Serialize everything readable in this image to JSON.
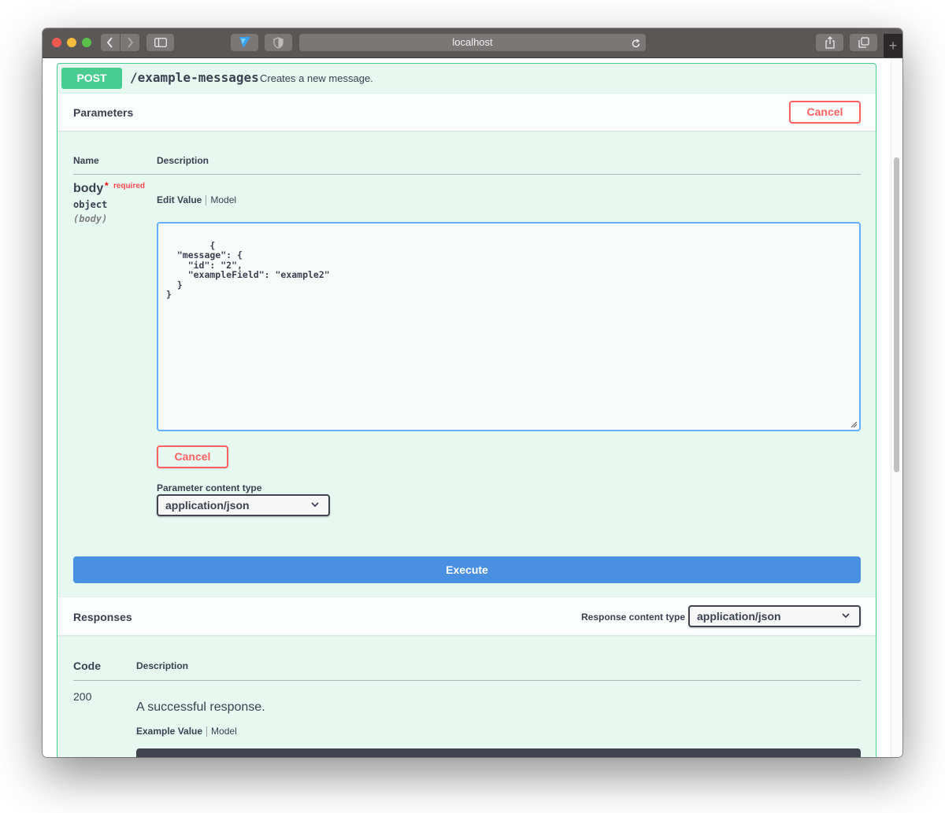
{
  "browser": {
    "url": "localhost",
    "icons": {
      "back": "chevron-left-icon",
      "forward": "chevron-right-icon",
      "sidebar": "sidebar-icon",
      "extension_v": "v-extension-icon",
      "extension_shield": "shield-icon",
      "reload": "reload-icon",
      "share": "share-icon",
      "tabs": "tabs-overview-icon",
      "new_tab": "plus-icon"
    },
    "new_tab_glyph": "+"
  },
  "operation": {
    "method": "POST",
    "path": "/example-messages",
    "summary": "Creates a new message."
  },
  "parameters": {
    "title": "Parameters",
    "cancel_label": "Cancel",
    "columns": {
      "name": "Name",
      "description": "Description"
    },
    "param": {
      "name": "body",
      "required_star": "*",
      "required_text": "required",
      "type": "object",
      "in": "(body)"
    },
    "tabs": {
      "edit_value": "Edit Value",
      "model": "Model"
    },
    "body_value": "{\n  \"message\": {\n    \"id\": \"2\",\n    \"exampleField\": \"example2\"\n  }\n}",
    "inline_cancel_label": "Cancel",
    "content_type_label": "Parameter content type",
    "content_type_value": "application/json"
  },
  "execute_label": "Execute",
  "responses": {
    "title": "Responses",
    "content_type_label": "Response content type",
    "content_type_value": "application/json",
    "columns": {
      "code": "Code",
      "description": "Description"
    },
    "items": [
      {
        "code": "200",
        "description": "A successful response.",
        "tabs": {
          "example_value": "Example Value",
          "model": "Model"
        }
      }
    ]
  },
  "colors": {
    "post_green": "#49cc90",
    "cancel_red": "#ff6060",
    "execute_blue": "#4990e2",
    "editor_border": "#61affe"
  }
}
